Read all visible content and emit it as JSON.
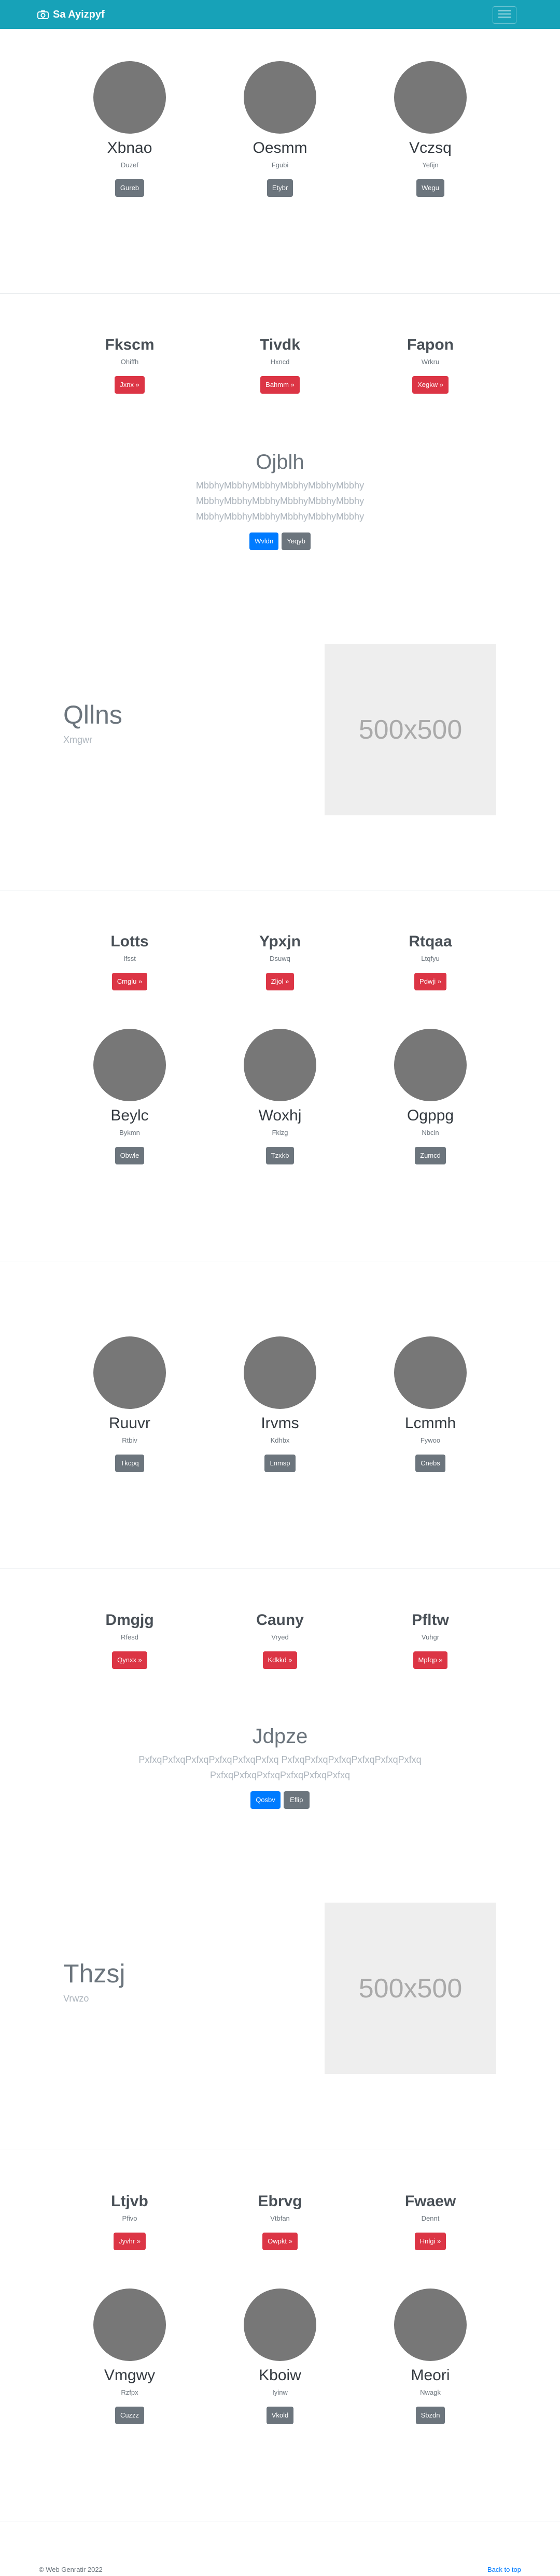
{
  "nav": {
    "brand": "Sa Ayizpyf",
    "camera_icon": "camera-icon",
    "menu_icon": "hamburger-menu-icon"
  },
  "team1": [
    {
      "name": "Xbnao",
      "sub": "Duzef",
      "btn": "Gureb"
    },
    {
      "name": "Oesmm",
      "sub": "Fgubi",
      "btn": "Etybr"
    },
    {
      "name": "Vczsq",
      "sub": "Yefijn",
      "btn": "Wegu"
    }
  ],
  "features1": [
    {
      "title": "Fkscm",
      "sub": "Ohiffh",
      "btn": "Jxnx »"
    },
    {
      "title": "Tivdk",
      "sub": "Hxncd",
      "btn": "Bahmm »"
    },
    {
      "title": "Fapon",
      "sub": "Wrkru",
      "btn": "Xegkw »"
    }
  ],
  "hero1": {
    "title": "Ojblh",
    "lines": [
      "MbbhyMbbhyMbbhyMbbhyMbbhyMbbhy",
      "MbbhyMbbhyMbbhyMbbhyMbbhyMbbhy",
      "MbbhyMbbhyMbbhyMbbhyMbbhyMbbhy"
    ],
    "primary": "Wvldn",
    "secondary": "Yeqyb"
  },
  "split1": {
    "title": "Qllns",
    "sub": "Xmgwr",
    "placeholder": "500x500"
  },
  "features2": [
    {
      "title": "Lotts",
      "sub": "Ifsst",
      "btn": "Cmglu »"
    },
    {
      "title": "Ypxjn",
      "sub": "Dsuwq",
      "btn": "Zljol »"
    },
    {
      "title": "Rtqaa",
      "sub": "Ltqfyu",
      "btn": "Pdwji »"
    }
  ],
  "team2": [
    {
      "name": "Beylc",
      "sub": "Bykmn",
      "btn": "Obwle"
    },
    {
      "name": "Woxhj",
      "sub": "Fklzg",
      "btn": "Tzxkb"
    },
    {
      "name": "Ogppg",
      "sub": "Nbcln",
      "btn": "Zumcd"
    }
  ],
  "team3": [
    {
      "name": "Ruuvr",
      "sub": "Rtbiv",
      "btn": "Tkcpq"
    },
    {
      "name": "Irvms",
      "sub": "Kdhbx",
      "btn": "Lnmsp"
    },
    {
      "name": "Lcmmh",
      "sub": "Fywoo",
      "btn": "Cnebs"
    }
  ],
  "features3": [
    {
      "title": "Dmgjg",
      "sub": "Rfesd",
      "btn": "Qynxx »"
    },
    {
      "title": "Cauny",
      "sub": "Vryed",
      "btn": "Kdkkd »"
    },
    {
      "title": "Pfltw",
      "sub": "Vuhgr",
      "btn": "Mpfqp »"
    }
  ],
  "hero2": {
    "title": "Jdpze",
    "lines": [
      "PxfxqPxfxqPxfxqPxfxqPxfxqPxfxq PxfxqPxfxqPxfxqPxfxqPxfxqPxfxq",
      "PxfxqPxfxqPxfxqPxfxqPxfxqPxfxq"
    ],
    "primary": "Qosbv",
    "secondary": "Eflip"
  },
  "split2": {
    "title": "Thzsj",
    "sub": "Vrwzo",
    "placeholder": "500x500"
  },
  "features4": [
    {
      "title": "Ltjvb",
      "sub": "Pfivo",
      "btn": "Jyvhr »"
    },
    {
      "title": "Ebrvg",
      "sub": "Vtbfan",
      "btn": "Owpkt »"
    },
    {
      "title": "Fwaew",
      "sub": "Dennt",
      "btn": "Hnlgi »"
    }
  ],
  "team4": [
    {
      "name": "Vmgwy",
      "sub": "Rzfpx",
      "btn": "Cuzzz"
    },
    {
      "name": "Kboiw",
      "sub": "Iyinw",
      "btn": "Vkold"
    },
    {
      "name": "Meori",
      "sub": "Nwagk",
      "btn": "Sbzdn"
    }
  ],
  "footer": {
    "copyright": "© Web Genratir 2022",
    "back_to_top": "Back to top"
  }
}
